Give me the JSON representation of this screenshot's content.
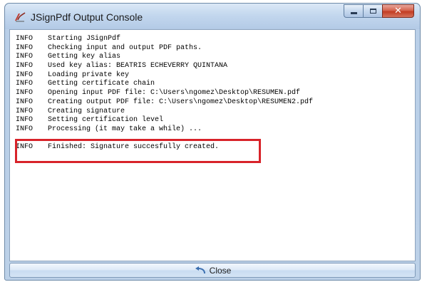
{
  "window": {
    "title": "JSignPdf Output Console",
    "caption_buttons": {
      "minimize_icon": "minimize-icon",
      "maximize_icon": "maximize-icon",
      "close_glyph": "✕"
    }
  },
  "console": {
    "lines": [
      {
        "level": "INFO",
        "message": "Starting JSignPdf"
      },
      {
        "level": "INFO",
        "message": "Checking input and output PDF paths."
      },
      {
        "level": "INFO",
        "message": "Getting key alias"
      },
      {
        "level": "INFO",
        "message": "Used key alias: BEATRIS ECHEVERRY QUINTANA"
      },
      {
        "level": "INFO",
        "message": "Loading private key"
      },
      {
        "level": "INFO",
        "message": "Getting certificate chain"
      },
      {
        "level": "INFO",
        "message": "Opening input PDF file: C:\\Users\\ngomez\\Desktop\\RESUMEN.pdf"
      },
      {
        "level": "INFO",
        "message": "Creating output PDF file: C:\\Users\\ngomez\\Desktop\\RESUMEN2.pdf"
      },
      {
        "level": "INFO",
        "message": "Creating signature"
      },
      {
        "level": "INFO",
        "message": "Setting certification level"
      },
      {
        "level": "INFO",
        "message": "Processing (it may take a while) ..."
      },
      {
        "level": "",
        "message": ""
      },
      {
        "level": "INFO",
        "message": "Finished: Signature succesfully created."
      }
    ],
    "highlight_color": "#d8232a"
  },
  "footer": {
    "close_label": "Close",
    "close_icon": "undo-arrow-icon"
  },
  "colors": {
    "title_bar": "#c3d7ee",
    "close_button": "#c23c22",
    "console_background": "#ffffff"
  }
}
